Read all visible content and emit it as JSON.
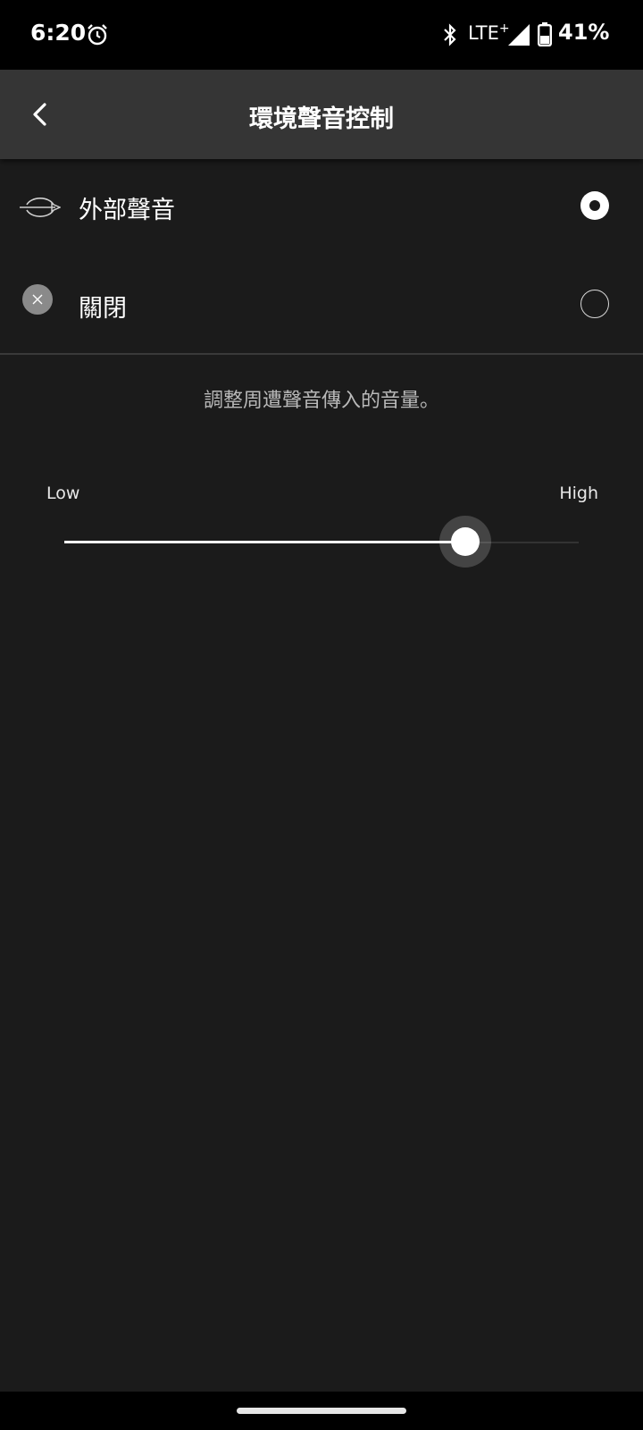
{
  "status_bar": {
    "time": "6:20",
    "network": "LTE",
    "network_plus": "+",
    "battery": "41%"
  },
  "header": {
    "title": "環境聲音控制",
    "back_icon": "chevron-left-icon"
  },
  "options": [
    {
      "label": "外部聲音",
      "icon": "ambient-sound-icon",
      "selected": true
    },
    {
      "label": "關閉",
      "icon": "close-circle-icon",
      "selected": false
    }
  ],
  "description": "調整周遭聲音傳入的音量。",
  "slider": {
    "low_label": "Low",
    "high_label": "High",
    "value": 0.78
  },
  "colors": {
    "background": "#1b1b1b",
    "app_bar": "#353535",
    "accent": "#ffffff"
  }
}
